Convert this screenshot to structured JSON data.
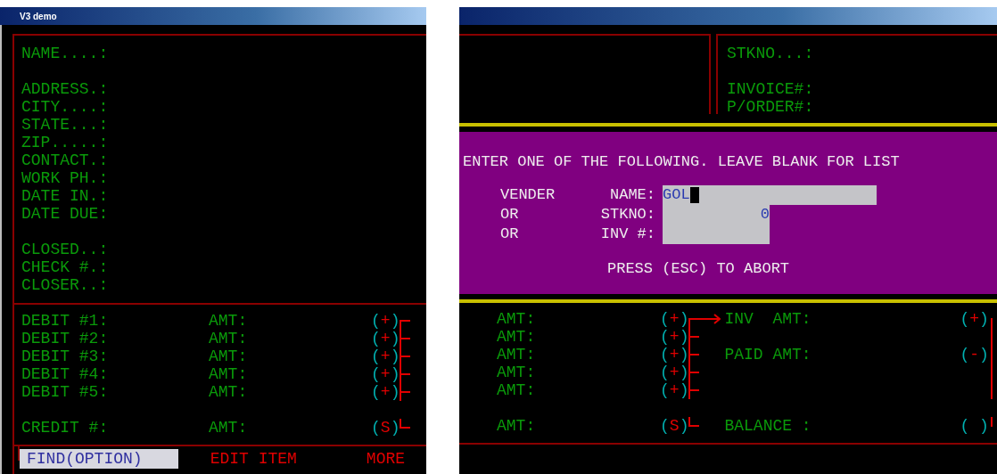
{
  "window": {
    "title": "V3 demo"
  },
  "customer_fields": [
    {
      "fields": [
        "NAME....:"
      ]
    },
    {
      "fields": [
        "ADDRESS.:",
        "CITY....:",
        "STATE...:",
        "ZIP.....:",
        "CONTACT.:",
        "WORK PH.:",
        "DATE IN.:",
        "DATE DUE:"
      ]
    },
    {
      "fields": [
        "CLOSED..:",
        "CHECK #.:",
        "CLOSER..:"
      ]
    }
  ],
  "invoice_fields": [
    {
      "fields": [
        "STKNO...:"
      ]
    },
    {
      "fields": [
        "INVOICE#:",
        "P/ORDER#:"
      ]
    }
  ],
  "dialog": {
    "prompt": "ENTER ONE OF THE FOLLOWING. LEAVE BLANK FOR LIST",
    "fields": [
      {
        "prefix": "VENDER",
        "label": "NAME:",
        "value": "GOL",
        "focused": true,
        "kind": "wide"
      },
      {
        "prefix": "OR",
        "label": "STKNO:",
        "value": "0",
        "kind": "numeric"
      },
      {
        "prefix": "OR",
        "label": "INV #:",
        "kind": "short"
      }
    ],
    "hint": "PRESS (ESC) TO ABORT"
  },
  "debits": [
    {
      "label": "DEBIT #1:",
      "amt": "AMT:",
      "sign": "(+)",
      "amt_2": "AMT:",
      "sign_2": "(+)",
      "total": {
        "label": "INV  AMT:",
        "sign": "(+)",
        "arrow": true
      }
    },
    {
      "label": "DEBIT #2:",
      "amt": "AMT:",
      "sign": "(+)",
      "amt_2": "AMT:",
      "sign_2": "(+)"
    },
    {
      "label": "DEBIT #3:",
      "amt": "AMT:",
      "sign": "(+)",
      "amt_2": "AMT:",
      "sign_2": "(+)",
      "total": {
        "label": "PAID AMT:",
        "sign": "(-)"
      }
    },
    {
      "label": "DEBIT #4:",
      "amt": "AMT:",
      "sign": "(+)",
      "amt_2": "AMT:",
      "sign_2": "(+)"
    },
    {
      "label": "DEBIT #5:",
      "amt": "AMT:",
      "sign": "(+)",
      "amt_2": "AMT:",
      "sign_2": "(+)"
    }
  ],
  "credit": {
    "label": "CREDIT #:",
    "amt": "AMT:",
    "sign": "(S)",
    "amt_2": "AMT:",
    "sign_2": "(S)",
    "total": {
      "label": "BALANCE :",
      "sign": "( )"
    }
  },
  "menu": [
    {
      "label": "FIND(OPTION)",
      "selected": true
    },
    {
      "label": "EDIT ITEM",
      "selected": false
    },
    {
      "label": "MORE",
      "selected": false
    }
  ]
}
